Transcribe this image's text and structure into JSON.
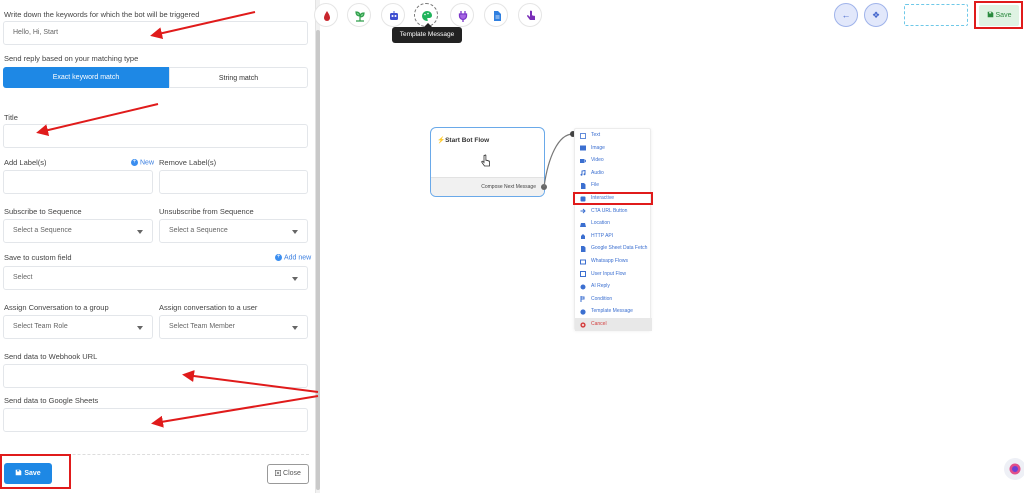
{
  "form": {
    "keywords_label": "Write down the keywords for which the bot will be triggered",
    "keywords_placeholder": "Hello, Hi, Start",
    "match_label": "Send reply based on your matching type",
    "match_options": [
      "Exact keyword match",
      "String match"
    ],
    "title_label": "Title",
    "add_labels": "Add Label(s)",
    "new_link": "New",
    "remove_labels": "Remove Label(s)",
    "subscribe_label": "Subscribe to Sequence",
    "unsubscribe_label": "Unsubscribe from Sequence",
    "select_sequence": "Select a Sequence",
    "custom_field_label": "Save to custom field",
    "add_new_link": "Add new",
    "select": "Select",
    "assign_group_label": "Assign Conversation to a group",
    "assign_user_label": "Assign conversation to a user",
    "select_team_role": "Select Team Role",
    "select_team_member": "Select Team Member",
    "webhook_label": "Send data to Webhook URL",
    "sheets_label": "Send data to Google Sheets",
    "save_button": "Save",
    "close_button": "Close"
  },
  "toolbar": {
    "tools": [
      "drop-icon",
      "plant-icon",
      "robot-icon",
      "palette-icon",
      "plug-icon",
      "document-icon",
      "hand-pointer-icon"
    ],
    "tooltip": "Template Message",
    "save_button": "Save"
  },
  "flow": {
    "start_title": "Start Bot Flow",
    "compose_label": "Compose Next Message"
  },
  "menu": {
    "items": [
      "Text",
      "Image",
      "Video",
      "Audio",
      "File",
      "Interactive",
      "CTA URL Button",
      "Location",
      "HTTP API",
      "Google Sheet Data Fetch",
      "Whatsapp Flows",
      "User Input Flow",
      "AI Reply",
      "Condition",
      "Template Message",
      "Cancel"
    ]
  },
  "colors": {
    "primary": "#1e88e5",
    "annotation_red": "#e01b1b",
    "save_green_bg": "#dff3e3"
  }
}
